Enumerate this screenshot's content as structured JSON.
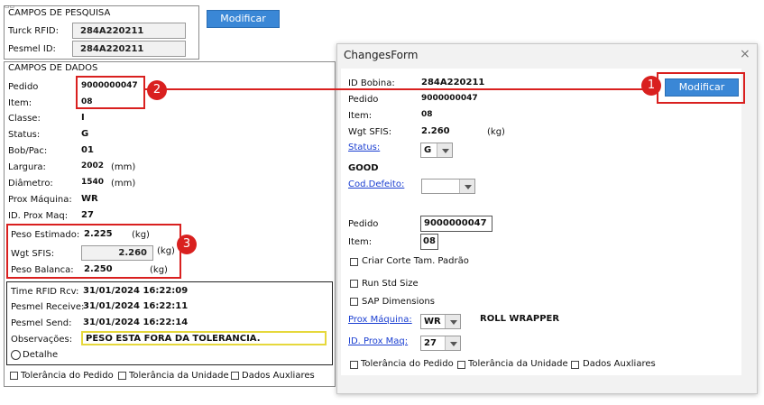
{
  "left": {
    "pesquisa": {
      "title": "CAMPOS DE PESQUISA",
      "turck_label": "Turck RFID:",
      "turck_value": "284A220211",
      "pesmel_label": "Pesmel ID:",
      "pesmel_value": "284A220211"
    },
    "modificar_label": "Modificar",
    "dados": {
      "title": "CAMPOS DE DADOS",
      "rows": [
        {
          "label": "Pedido",
          "value": "9000000047",
          "unit": ""
        },
        {
          "label": "Item:",
          "value": "08",
          "unit": ""
        },
        {
          "label": "Classe:",
          "value": "I",
          "unit": ""
        },
        {
          "label": "Status:",
          "value": "G",
          "unit": ""
        },
        {
          "label": "Bob/Pac:",
          "value": "01",
          "unit": ""
        },
        {
          "label": "Largura:",
          "value": "2002",
          "unit": "(mm)"
        },
        {
          "label": "Diâmetro:",
          "value": "1540",
          "unit": "(mm)"
        },
        {
          "label": "Prox Máquina:",
          "value": "WR",
          "unit": ""
        },
        {
          "label": "ID. Prox Maq:",
          "value": "27",
          "unit": ""
        }
      ],
      "peso_estimado_label": "Peso Estimado:",
      "peso_estimado_value": "2.225",
      "peso_estimado_unit": "(kg)",
      "wgt_sfis_label": "Wgt SFIS:",
      "wgt_sfis_value": "2.260",
      "wgt_sfis_unit": "(kg)",
      "peso_balanca_label": "Peso Balanca:",
      "peso_balanca_value": "2.250",
      "peso_balanca_unit": "(kg)"
    },
    "times": {
      "rfid_label": "Time RFID Rcv:",
      "rfid_value": "31/01/2024 16:22:09",
      "pesmel_receive_label": "Pesmel Receive:",
      "pesmel_receive_value": "31/01/2024 16:22:11",
      "pesmel_send_label": "Pesmel Send:",
      "pesmel_send_value": "31/01/2024 16:22:14",
      "obs_label": "Observações:",
      "obs_value": "PESO ESTA FORA DA TOLERANCIA.",
      "detalhe_label": "Detalhe"
    },
    "checks": {
      "tol_pedido": "Tolerância do Pedido",
      "tol_unidade": "Tolerância da Unidade",
      "dados_aux": "Dados Auxliares"
    }
  },
  "dialog": {
    "title": "ChangesForm",
    "close_glyph": "×",
    "id_bobina_label": "ID Bobina:",
    "id_bobina_value": "284A220211",
    "modificar_label": "Modificar",
    "pedido_label": "Pedido",
    "pedido_value": "9000000047",
    "item_label": "Item:",
    "item_value": "08",
    "wgt_label": "Wgt SFIS:",
    "wgt_value": "2.260",
    "wgt_unit": "(kg)",
    "status_link": "Status:",
    "status_value": "G",
    "status_text": "GOOD",
    "cod_defeito_link": "Cod.Defeito:",
    "pedido2_label": "Pedido",
    "pedido2_value": "9000000047",
    "item2_label": "Item:",
    "item2_value": "08",
    "chk_criar": "Criar Corte Tam. Padrão",
    "chk_run": "Run Std Size",
    "chk_sap": "SAP Dimensions",
    "prox_maquina_link": "Prox Máquina:",
    "prox_maquina_value": "WR",
    "prox_maquina_text": "ROLL WRAPPER",
    "id_prox_link": "ID. Prox Maq:",
    "id_prox_value": "27",
    "tol_pedido": "Tolerância do Pedido",
    "tol_unidade": "Tolerância da Unidade",
    "dados_aux": "Dados Auxliares"
  },
  "badges": [
    "1",
    "2",
    "3"
  ],
  "colors": {
    "accent": "#3a87d6",
    "highlight": "#d9201f",
    "obs_border": "#e6d83c"
  }
}
